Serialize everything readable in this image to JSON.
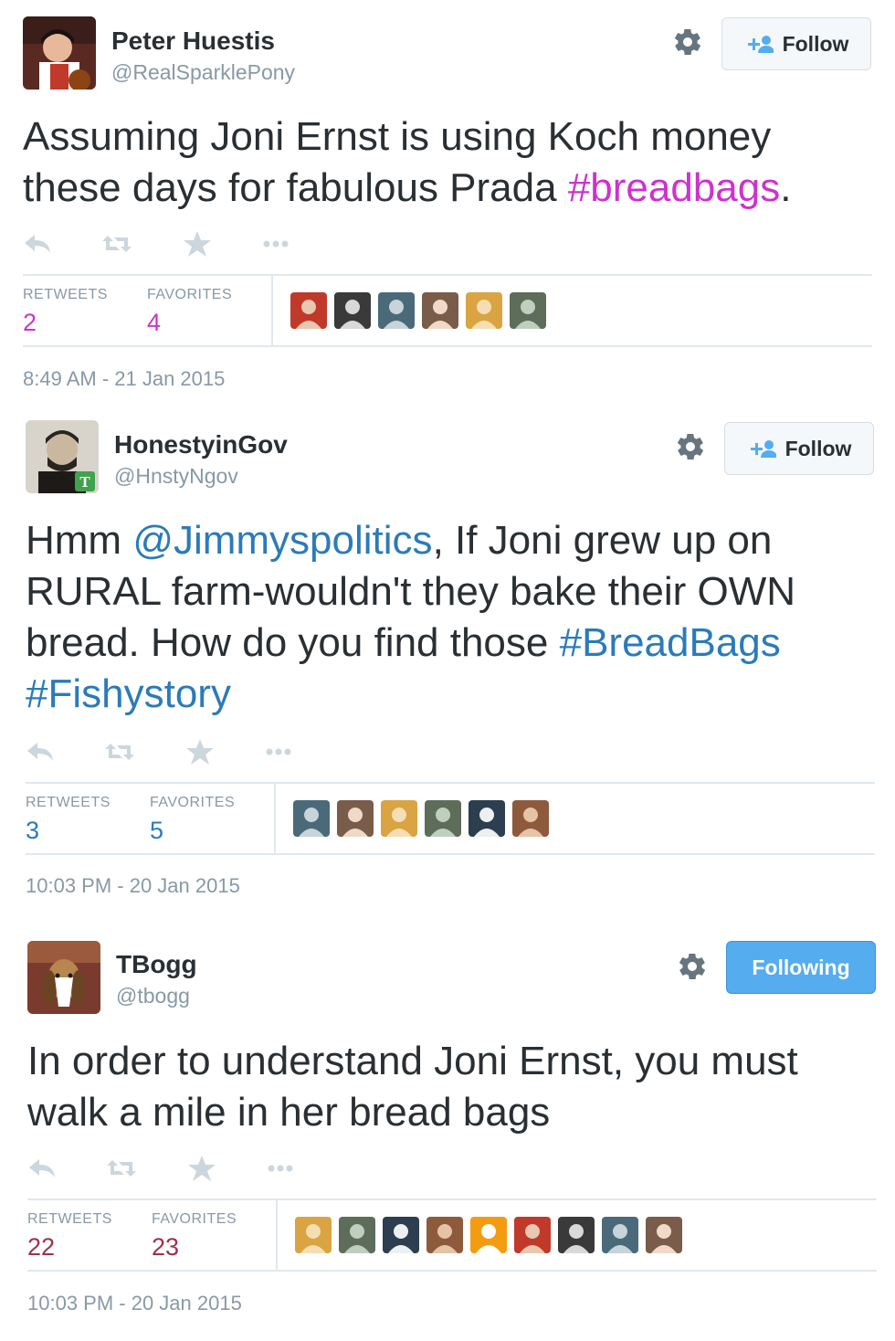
{
  "accent": "#55acee",
  "tweets": [
    {
      "name": "Peter Huestis",
      "handle": "@RealSparklePony",
      "follow_label": "Follow",
      "follow_state": "not-following",
      "link_color": "#cc33cc",
      "text_parts": [
        {
          "t": "Assuming Joni Ernst is using Koch money these days for fabulous Prada ",
          "link": false
        },
        {
          "t": "#breadbags",
          "link": true
        },
        {
          "t": ".",
          "link": false
        }
      ],
      "retweets_label": "RETWEETS",
      "retweets": "2",
      "favorites_label": "FAVORITES",
      "favorites": "4",
      "favoriter_count": 6,
      "timestamp": "8:49 AM - 21 Jan 2015"
    },
    {
      "name": "HonestyinGov",
      "handle": "@HnstyNgov",
      "follow_label": "Follow",
      "follow_state": "not-following",
      "link_color": "#2b7bb9",
      "text_parts": [
        {
          "t": "Hmm ",
          "link": false
        },
        {
          "t": "@Jimmyspolitics",
          "link": true
        },
        {
          "t": ", If Joni grew up on RURAL farm-wouldn't they bake their OWN bread. How do you find those ",
          "link": false
        },
        {
          "t": "#BreadBags",
          "link": true
        },
        {
          "t": " ",
          "link": false
        },
        {
          "t": "#Fishystory",
          "link": true
        }
      ],
      "retweets_label": "RETWEETS",
      "retweets": "3",
      "favorites_label": "FAVORITES",
      "favorites": "5",
      "favoriter_count": 6,
      "timestamp": "10:03 PM - 20 Jan 2015"
    },
    {
      "name": "TBogg",
      "handle": "@tbogg",
      "follow_label": "Following",
      "follow_state": "following",
      "link_color": "#a0304a",
      "text_parts": [
        {
          "t": "In order to understand Joni Ernst, you must walk a mile in her bread bags",
          "link": false
        }
      ],
      "retweets_label": "RETWEETS",
      "retweets": "22",
      "favorites_label": "FAVORITES",
      "favorites": "23",
      "favoriter_count": 9,
      "timestamp": "10:03 PM - 20 Jan 2015"
    }
  ]
}
